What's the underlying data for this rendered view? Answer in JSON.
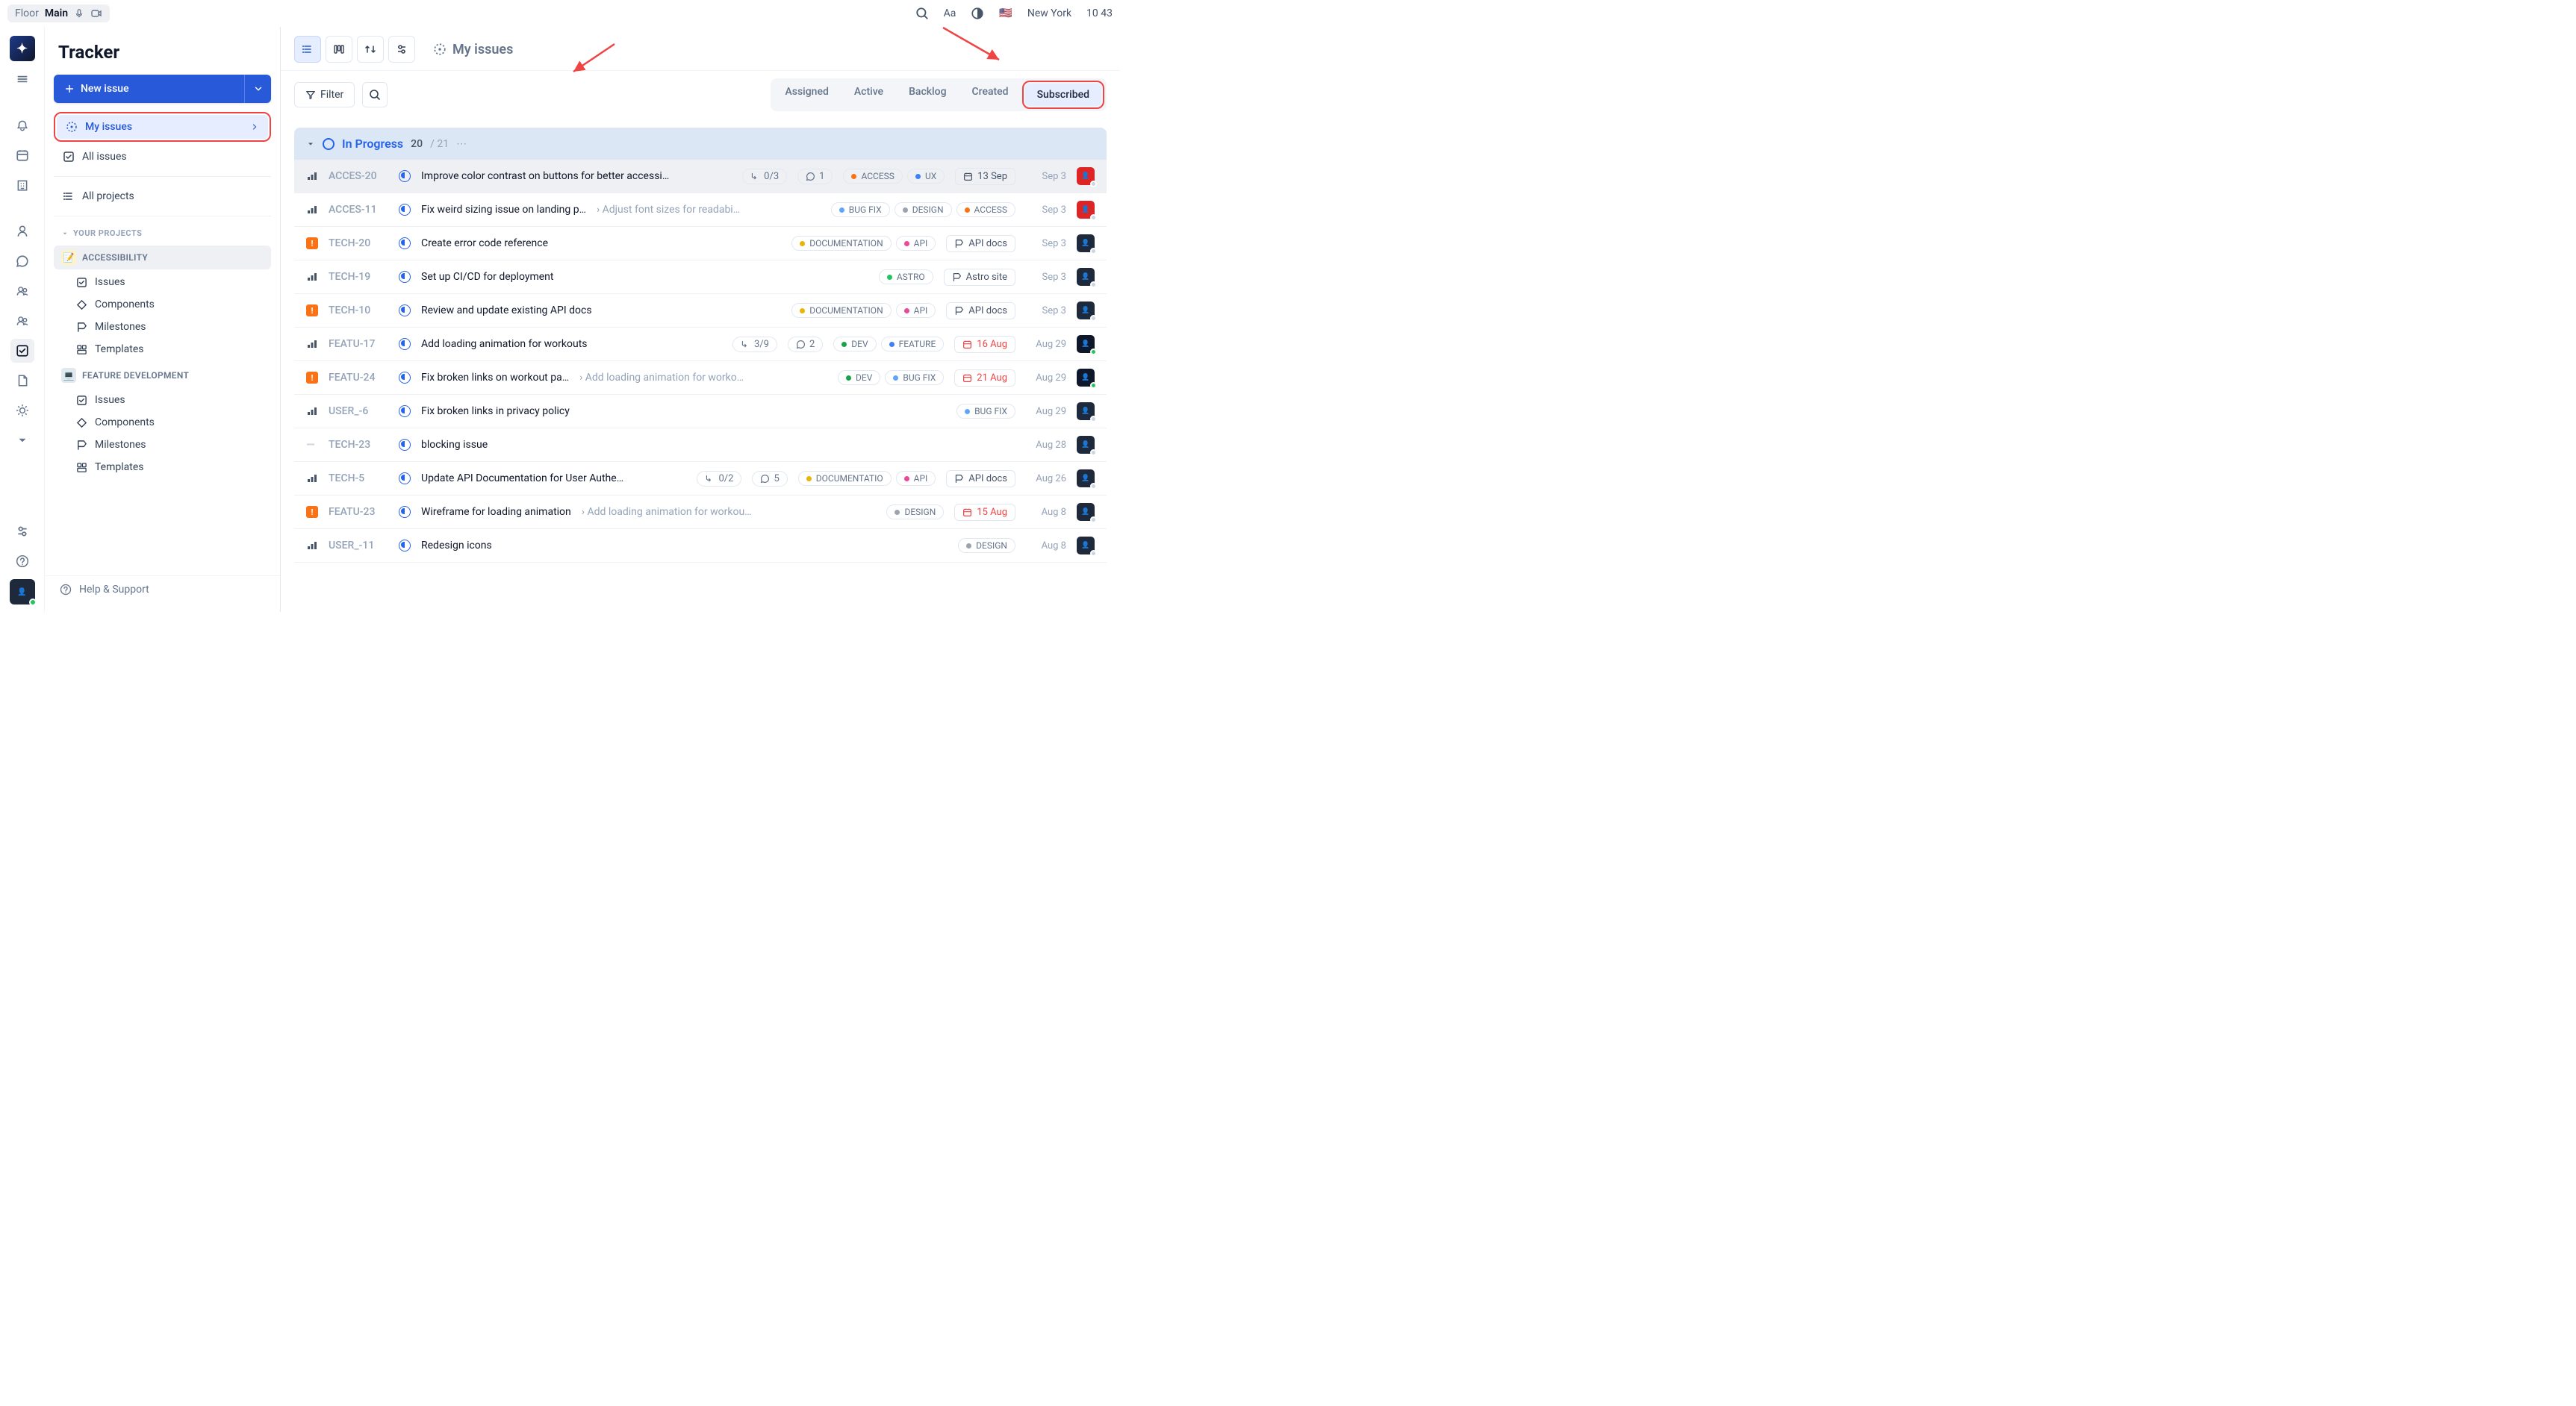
{
  "topbar": {
    "floor_label": "Floor",
    "floor_value": "Main",
    "location": "New York",
    "time": "10 43",
    "flag": "🇺🇸"
  },
  "sidebar": {
    "title": "Tracker",
    "new_issue": "New issue",
    "my_issues": "My issues",
    "all_issues": "All issues",
    "all_projects": "All projects",
    "your_projects_hdr": "YOUR PROJECTS",
    "projects": [
      {
        "name": "ACCESSIBILITY",
        "icon": "📝",
        "active": true,
        "items": [
          "Issues",
          "Components",
          "Milestones",
          "Templates"
        ]
      },
      {
        "name": "FEATURE DEVELOPMENT",
        "icon": "💻",
        "active": false,
        "items": [
          "Issues",
          "Components",
          "Milestones",
          "Templates"
        ]
      }
    ],
    "help": "Help & Support"
  },
  "main": {
    "page_title": "My issues",
    "filter_label": "Filter",
    "tabs": [
      "Assigned",
      "Active",
      "Backlog",
      "Created",
      "Subscribed"
    ],
    "active_tab": "Subscribed",
    "group": {
      "name": "In Progress",
      "count": "20",
      "total": "/ 21"
    },
    "font_button": "Aa"
  },
  "issues": [
    {
      "prio": "bars",
      "id": "ACCES-20",
      "title": "Improve color contrast on buttons for better accessi…",
      "parent": "",
      "sub": "0/3",
      "comments": "1",
      "tags": [
        {
          "t": "ACCESS",
          "c": "#f97316"
        },
        {
          "t": "UX",
          "c": "#3b82f6"
        }
      ],
      "due": "13 Sep",
      "due_overdue": false,
      "mod": "Sep 3",
      "avatar": "a1"
    },
    {
      "prio": "bars",
      "id": "ACCES-11",
      "title": "Fix weird sizing issue on landing p…",
      "parent": "› Adjust font sizes for readabi…",
      "sub": "",
      "comments": "",
      "tags": [
        {
          "t": "BUG FIX",
          "c": "#60a5fa"
        },
        {
          "t": "DESIGN",
          "c": "#9ca3af"
        },
        {
          "t": "ACCESS",
          "c": "#f97316"
        }
      ],
      "due": "",
      "mod": "Sep 3",
      "avatar": "a1"
    },
    {
      "prio": "urgent",
      "id": "TECH-20",
      "title": "Create error code reference",
      "parent": "",
      "sub": "",
      "comments": "",
      "tags": [
        {
          "t": "DOCUMENTATION",
          "c": "#eab308"
        },
        {
          "t": "API",
          "c": "#ec4899"
        }
      ],
      "due": "API docs",
      "due_icon": "ms",
      "mod": "Sep 3",
      "avatar": "a2"
    },
    {
      "prio": "bars",
      "id": "TECH-19",
      "title": "Set up CI/CD for deployment",
      "parent": "",
      "sub": "",
      "comments": "",
      "tags": [
        {
          "t": "ASTRO",
          "c": "#22c55e"
        }
      ],
      "due": "Astro site",
      "due_icon": "ms",
      "mod": "Sep 3",
      "avatar": "a2"
    },
    {
      "prio": "urgent",
      "id": "TECH-10",
      "title": "Review and update existing API docs",
      "parent": "",
      "sub": "",
      "comments": "",
      "tags": [
        {
          "t": "DOCUMENTATION",
          "c": "#eab308"
        },
        {
          "t": "API",
          "c": "#ec4899"
        }
      ],
      "due": "API docs",
      "due_icon": "ms",
      "mod": "Sep 3",
      "avatar": "a2"
    },
    {
      "prio": "bars",
      "id": "FEATU-17",
      "title": "Add loading animation for workouts",
      "parent": "",
      "sub": "3/9",
      "comments": "2",
      "tags": [
        {
          "t": "DEV",
          "c": "#16a34a"
        },
        {
          "t": "FEATURE",
          "c": "#3b82f6"
        }
      ],
      "due": "16 Aug",
      "due_overdue": true,
      "mod": "Aug 29",
      "avatar": "a3"
    },
    {
      "prio": "urgent",
      "id": "FEATU-24",
      "title": "Fix broken links on workout pa…",
      "parent": "› Add loading animation for worko…",
      "sub": "",
      "comments": "",
      "tags": [
        {
          "t": "DEV",
          "c": "#16a34a"
        },
        {
          "t": "BUG FIX",
          "c": "#60a5fa"
        }
      ],
      "due": "21 Aug",
      "due_overdue": true,
      "mod": "Aug 29",
      "avatar": "a3"
    },
    {
      "prio": "bars",
      "id": "USER_-6",
      "title": "Fix broken links in privacy policy",
      "parent": "",
      "sub": "",
      "comments": "",
      "tags": [
        {
          "t": "BUG FIX",
          "c": "#60a5fa"
        }
      ],
      "due": "",
      "mod": "Aug 29",
      "avatar": "a2"
    },
    {
      "prio": "none",
      "id": "TECH-23",
      "title": "blocking issue",
      "parent": "",
      "sub": "",
      "comments": "",
      "tags": [],
      "due": "",
      "mod": "Aug 28",
      "avatar": "a2"
    },
    {
      "prio": "bars",
      "id": "TECH-5",
      "title": "Update API Documentation for User Authe…",
      "parent": "",
      "sub": "0/2",
      "comments": "5",
      "tags": [
        {
          "t": "DOCUMENTATIO",
          "c": "#eab308"
        },
        {
          "t": "API",
          "c": "#ec4899"
        }
      ],
      "due": "API docs",
      "due_icon": "ms",
      "mod": "Aug 26",
      "avatar": "a2"
    },
    {
      "prio": "urgent",
      "id": "FEATU-23",
      "title": "Wireframe for loading animation",
      "parent": "› Add loading animation for workouts",
      "sub": "",
      "comments": "",
      "tags": [
        {
          "t": "DESIGN",
          "c": "#9ca3af"
        }
      ],
      "due": "15 Aug",
      "due_overdue": true,
      "mod": "Aug 8",
      "avatar": "a2"
    },
    {
      "prio": "bars",
      "id": "USER_-11",
      "title": "Redesign icons",
      "parent": "",
      "sub": "",
      "comments": "",
      "tags": [
        {
          "t": "DESIGN",
          "c": "#9ca3af"
        }
      ],
      "due": "",
      "mod": "Aug 8",
      "avatar": "a2"
    }
  ],
  "colors": {
    "avatars": {
      "a1": "#dc2626",
      "a2": "#1e293b",
      "a3": "#0f172a"
    }
  }
}
